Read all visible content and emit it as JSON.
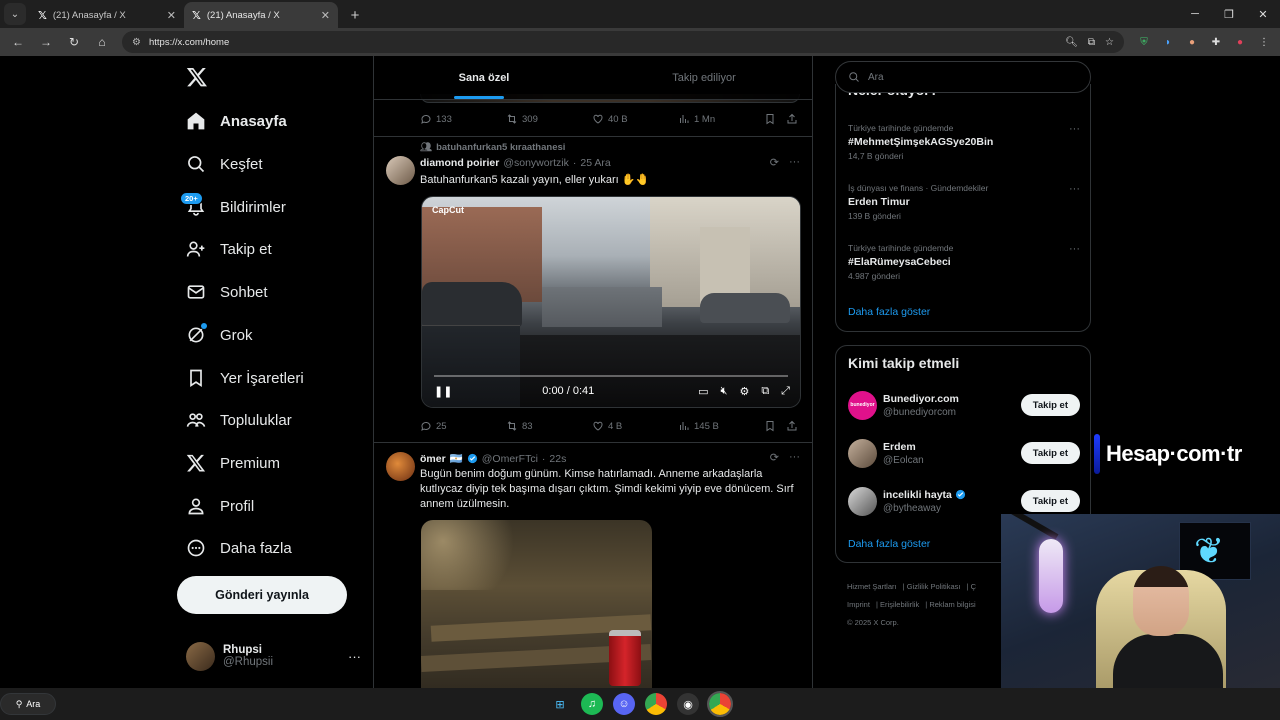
{
  "browser": {
    "tabs": [
      {
        "title": "(21) Anasayfa / X",
        "active": false
      },
      {
        "title": "(21) Anasayfa / X",
        "active": true
      }
    ],
    "url": "https://x.com/home"
  },
  "nav": {
    "items": [
      {
        "label": "Anasayfa",
        "icon": "home-icon"
      },
      {
        "label": "Keşfet",
        "icon": "search-icon"
      },
      {
        "label": "Bildirimler",
        "icon": "bell-icon",
        "badge": "20+"
      },
      {
        "label": "Takip et",
        "icon": "follow-icon"
      },
      {
        "label": "Sohbet",
        "icon": "mail-icon"
      },
      {
        "label": "Grok",
        "icon": "grok-icon"
      },
      {
        "label": "Yer İşaretleri",
        "icon": "bookmark-icon"
      },
      {
        "label": "Topluluklar",
        "icon": "communities-icon"
      },
      {
        "label": "Premium",
        "icon": "x-icon"
      },
      {
        "label": "Profil",
        "icon": "profile-icon"
      },
      {
        "label": "Daha fazla",
        "icon": "more-circle-icon"
      }
    ],
    "post_button": "Gönderi yayınla",
    "profile": {
      "name": "Rhupsi",
      "handle": "@Rhupsii"
    }
  },
  "feed": {
    "tabs": [
      "Sana özel",
      "Takip ediliyor"
    ],
    "prev_actions": {
      "replies": "133",
      "reposts": "309",
      "likes": "40 B",
      "views": "1 Mn"
    },
    "tweet1": {
      "context": "batuhanfurkan5 kıraathanesi",
      "name": "diamond poirier",
      "handle": "@sonywortzik",
      "time": "25 Ara",
      "text": "Batuhanfurkan5 kazalı yayın, eller yukarı ✋🤚",
      "video": {
        "watermark": "CapCut",
        "time": "0:00 / 0:41"
      },
      "actions": {
        "replies": "25",
        "reposts": "83",
        "likes": "4 B",
        "views": "145 B"
      }
    },
    "tweet2": {
      "name": "ömer",
      "flag": "🇦🇷",
      "handle": "@OmerFTci",
      "time": "22s",
      "text": "Bugün benim doğum günüm. Kimse hatırlamadı. Anneme arkadaşlarla kutlıycaz diyip tek başıma dışarı çıktım. Şimdi kekimi yiyip eve dönücem. Sırf annem üzülmesin."
    }
  },
  "right": {
    "search_placeholder": "Ara",
    "trends_title": "Neler oluyor?",
    "trends": [
      {
        "category": "Türkiye tarihinde gündemde",
        "name": "#MehmetŞimşekAGSye20Bin",
        "count": "14,7 B gönderi"
      },
      {
        "category": "İş dünyası ve finans · Gündemdekiler",
        "name": "Erden Timur",
        "count": "139 B gönderi"
      },
      {
        "category": "Türkiye tarihinde gündemde",
        "name": "#ElaRümeysaCebeci",
        "count": "4.987 gönderi"
      }
    ],
    "show_more": "Daha fazla göster",
    "who_title": "Kimi takip etmeli",
    "who": [
      {
        "name": "Bunediyor.com",
        "handle": "@bunediyorcom",
        "avatar_text": "bunediyor",
        "avatar_color": "#e0118b",
        "verified": false
      },
      {
        "name": "Erdem",
        "handle": "@Eolcan",
        "avatar_text": "",
        "avatar_color": "#7a6a5a",
        "verified": false
      },
      {
        "name": "incelikli hayta",
        "handle": "@bytheaway",
        "avatar_text": "",
        "avatar_color": "#9a9a9a",
        "verified": true
      }
    ],
    "follow_label": "Takip et",
    "footer": [
      "Hizmet Şartları",
      "Gizlilik Politikası",
      "Ç",
      "Imprint",
      "Erişilebilirlik",
      "Reklam bilgisi",
      "© 2025 X Corp."
    ]
  },
  "overlay": {
    "brand": "Hesap·com·tr"
  },
  "taskbar": {
    "search_label": "Ara"
  },
  "colors": {
    "accent": "#1d9bf0",
    "bg": "#000000",
    "muted": "#71767b",
    "border": "#2f3336"
  }
}
